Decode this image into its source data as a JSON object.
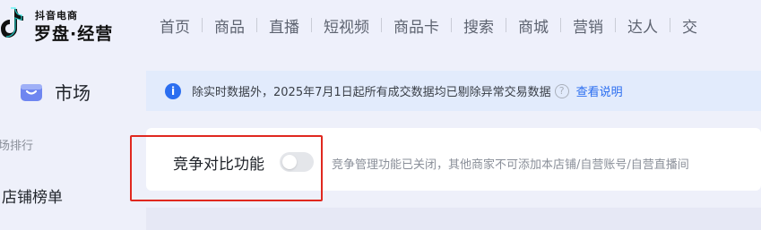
{
  "brand": {
    "sub": "抖音电商",
    "main": "罗盘·经营"
  },
  "nav": {
    "items": [
      {
        "label": "首页"
      },
      {
        "label": "商品"
      },
      {
        "label": "直播"
      },
      {
        "label": "短视频"
      },
      {
        "label": "商品卡"
      },
      {
        "label": "搜索"
      },
      {
        "label": "商城"
      },
      {
        "label": "营销"
      },
      {
        "label": "达人"
      },
      {
        "label": "交"
      }
    ]
  },
  "sidebar": {
    "title": "市场",
    "section": "场排行",
    "item": "店铺榜单"
  },
  "notice": {
    "text": "除实时数据外，2025年7月1日起所有成交数据均已剔除异常交易数据",
    "link": "查看说明"
  },
  "feature": {
    "label": "竞争对比功能",
    "toggle_on": false,
    "description": "竞争管理功能已关闭，其他商家不可添加本店铺/自营账号/自营直播间"
  },
  "colors": {
    "accent": "#2b6ef0",
    "highlight": "#e0281f",
    "background": "#eef0fa"
  }
}
